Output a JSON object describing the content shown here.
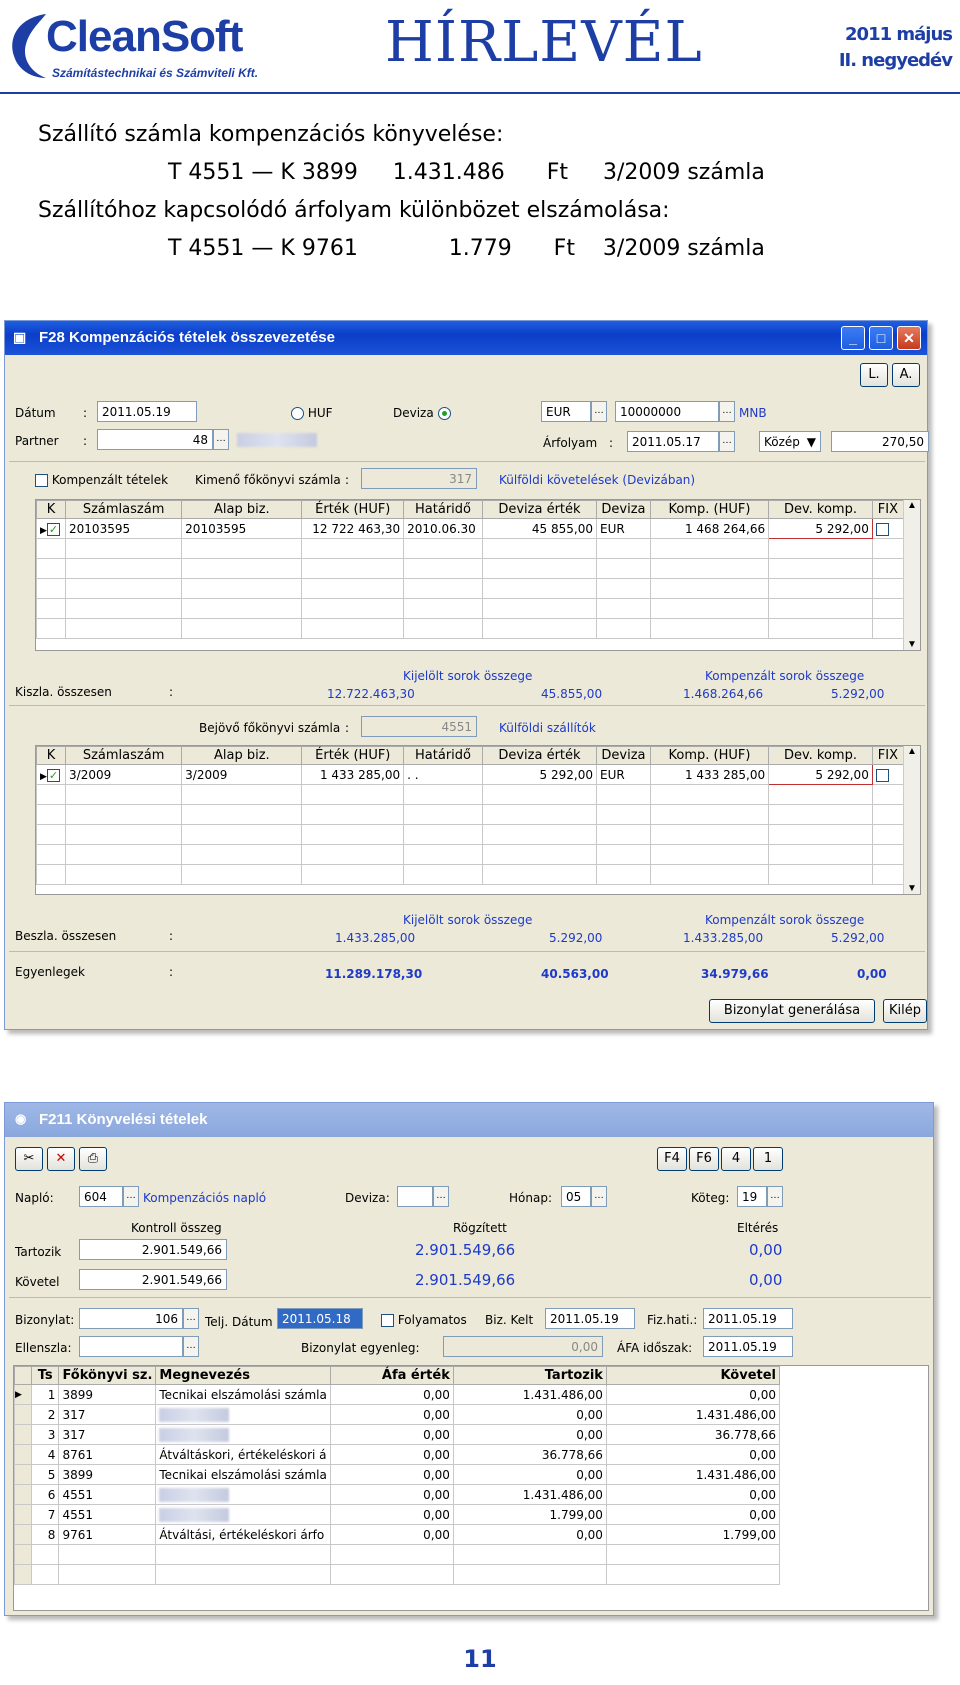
{
  "header": {
    "logo_main": "CleanSoft",
    "logo_sub": "Számítástechnikai és Számviteli Kft.",
    "title": "HÍRLEVÉL",
    "issue_line1": "2011 május",
    "issue_line2": "II. negyedév"
  },
  "intro": {
    "line1": "Szállító számla kompenzációs könyvelése:",
    "line2": "T 4551 — K 3899     1.431.486      Ft     3/2009 számla",
    "line3": "Szállítóhoz kapcsolódó árfolyam különbözet elszámolása:",
    "line4": "T 4551 — K 9761             1.779      Ft    3/2009 számla"
  },
  "f28": {
    "title": "F28 Kompenzációs tételek összevezetése",
    "btn_l": "L.",
    "btn_a": "A.",
    "datum_label": "Dátum",
    "datum_value": "2011.05.19",
    "colon": ":",
    "huf_label": "HUF",
    "deviza_label": "Deviza",
    "currency": "EUR",
    "amount": "10000000",
    "mnb": "MNB",
    "partner_label": "Partner",
    "partner_value": "48",
    "arfolyam_label": "Árfolyam",
    "arfolyam_date": "2011.05.17",
    "kozep": "Közép",
    "rate": "270,50",
    "komp_label": "Kompenzált tételek",
    "kimeno_label": "Kimenő főkönyvi számla",
    "kimeno_value": "317",
    "kulfoldi_kov": "Külföldi követelések (Devizában)",
    "columns": [
      "K",
      "Számlaszám",
      "Alap biz.",
      "Érték (HUF)",
      "Határidő",
      "Deviza érték",
      "Deviza",
      "Komp. (HUF)",
      "Dev. komp.",
      "FIX"
    ],
    "rows1": [
      [
        "20103595",
        "20103595",
        "12 722 463,30",
        "2010.06.30",
        "45 855,00",
        "EUR",
        "1 468 264,66",
        "5 292,00"
      ]
    ],
    "sum1_label": "Kiszla. összesen",
    "selected_label": "Kijelölt sorok összege",
    "comp_label": "Kompenzált sorok összege",
    "sum1": [
      "12.722.463,30",
      "45.855,00",
      "1.468.264,66",
      "5.292,00"
    ],
    "bejovo_label": "Bejövő főkönyvi számla",
    "bejovo_value": "4551",
    "kulfoldi_szall": "Külföldi szállítók",
    "rows2": [
      [
        "3/2009",
        "3/2009",
        "1 433 285,00",
        ". .",
        "5 292,00",
        "EUR",
        "1 433 285,00",
        "5 292,00"
      ]
    ],
    "sum2_label": "Beszla. összesen",
    "sum2": [
      "1.433.285,00",
      "5.292,00",
      "1.433.285,00",
      "5.292,00"
    ],
    "bal_label": "Egyenlegek",
    "bal": [
      "11.289.178,30",
      "40.563,00",
      "34.979,66",
      "0,00"
    ],
    "gen_btn": "Bizonylat generálása",
    "exit_btn": "Kilép"
  },
  "f211": {
    "title": "F211 Könyvelési tételek",
    "tool_btns": [
      "F4",
      "F6",
      "4",
      "1"
    ],
    "naplo_label": "Napló:",
    "naplo_value": "604",
    "naplo_name": "Kompenzációs napló",
    "deviza_label": "Deviza:",
    "honap_label": "Hónap:",
    "honap_value": "05",
    "koteg_label": "Köteg:",
    "koteg_value": "19",
    "kontroll": "Kontroll összeg",
    "rogzitett": "Rögzített",
    "elteres": "Eltérés",
    "tartozik_label": "Tartozik",
    "tartozik": [
      "2.901.549,66",
      "2.901.549,66",
      "0,00"
    ],
    "kovetel_label": "Követel",
    "kovetel": [
      "2.901.549,66",
      "2.901.549,66",
      "0,00"
    ],
    "bizonylat_label": "Bizonylat:",
    "bizonylat_value": "106",
    "telj_label": "Telj. Dátum",
    "telj_value": "2011.05.18",
    "folyamatos": "Folyamatos",
    "bizkelt_label": "Biz. Kelt",
    "bizkelt_value": "2011.05.19",
    "fizhati_label": "Fiz.hati.:",
    "fizhati_value": "2011.05.19",
    "ellenszla_label": "Ellenszla:",
    "egyenleg_label": "Bizonylat egyenleg:",
    "egyenleg_value": "0,00",
    "afa_label": "ÁFA időszak:",
    "afa_value": "2011.05.19",
    "columns": [
      "Ts",
      "Főkönyvi sz.",
      "Megnevezés",
      "Áfa érték",
      "Tartozik",
      "Követel"
    ],
    "rows": [
      [
        "1",
        "3899",
        "Tecnikai elszámolási számla",
        "0,00",
        "1.431.486,00",
        "0,00"
      ],
      [
        "2",
        "317",
        "",
        "0,00",
        "0,00",
        "1.431.486,00"
      ],
      [
        "3",
        "317",
        "",
        "0,00",
        "0,00",
        "36.778,66"
      ],
      [
        "4",
        "8761",
        "Átváltáskori, értékeléskori á",
        "0,00",
        "36.778,66",
        "0,00"
      ],
      [
        "5",
        "3899",
        "Tecnikai elszámolási számla",
        "0,00",
        "0,00",
        "1.431.486,00"
      ],
      [
        "6",
        "4551",
        "",
        "0,00",
        "1.431.486,00",
        "0,00"
      ],
      [
        "7",
        "4551",
        "",
        "0,00",
        "1.799,00",
        "0,00"
      ],
      [
        "8",
        "9761",
        "Átváltási, értékeléskori árfo",
        "0,00",
        "0,00",
        "1.799,00"
      ]
    ]
  },
  "page_number": "11"
}
